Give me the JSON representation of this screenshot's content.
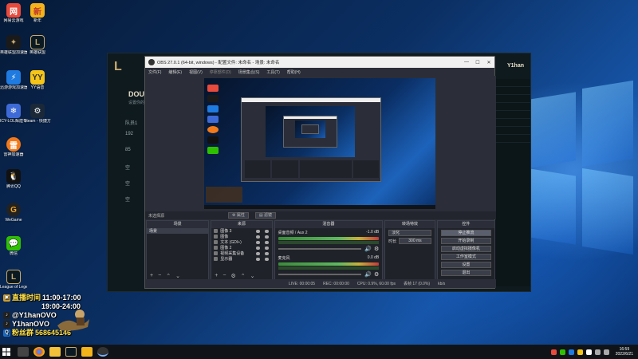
{
  "desktop": {
    "icons": [
      {
        "label": "网易云游戏",
        "icon": "netease-cloud-game-icon",
        "color": "#e84a3c"
      },
      {
        "label": "新年",
        "icon": "new-year-badge-icon",
        "color": "#f3b31b"
      },
      {
        "label": "英雄联盟加速器",
        "icon": "lol-accelerator-icon",
        "color": "#1a1a1a"
      },
      {
        "label": "英雄联盟",
        "icon": "league-of-legends-icon",
        "color": "#0b1a22"
      },
      {
        "label": "迅游游戏加速器",
        "icon": "xunyou-accelerator-icon",
        "color": "#1f7be0"
      },
      {
        "label": "YY语音",
        "icon": "yy-voice-icon",
        "color": "#f5c518"
      },
      {
        "label": "ICY-LOL辉煌专用版",
        "icon": "icy-lol-icon",
        "color": "#3d6ad6"
      },
      {
        "label": "Steam - 快捷方式",
        "icon": "steam-icon",
        "color": "#1b2838"
      },
      {
        "label": "雷神加速器",
        "icon": "leishen-accelerator-icon",
        "color": "#f27a1a"
      },
      {
        "label": "腾讯QQ",
        "icon": "qq-penguin-icon",
        "color": "#111111"
      },
      {
        "label": "WeGame",
        "icon": "wegame-icon",
        "color": "#222222"
      },
      {
        "label": "微信",
        "icon": "wechat-icon",
        "color": "#2dc100"
      },
      {
        "label": "League of Legends",
        "icon": "league-of-legends-icon",
        "color": "#0b1a22"
      }
    ]
  },
  "lol_client": {
    "title": "DOU",
    "subtitle": "设置你的...",
    "rows": [
      "队员1",
      "192",
      "85",
      "空",
      "空",
      "空"
    ],
    "user": "Y1han"
  },
  "obs": {
    "window_title": "OBS 27.0.1 (64-bit, windows) - 配置文件: 未命名 - 场景: 未命名",
    "menu": [
      "文件(F)",
      "编辑(E)",
      "视图(V)",
      "停靠部件(D)",
      "场景集合(S)",
      "工具(T)",
      "帮助(H)"
    ],
    "no_source": "未选择源",
    "properties_label": "属性",
    "filters_label": "滤镜",
    "docks": {
      "scenes": {
        "header": "场景",
        "items": [
          "场景"
        ]
      },
      "sources": {
        "header": "来源",
        "items": [
          "图像 3",
          "图像",
          "文本 (GDI+)",
          "图像 2",
          "视频采集设备",
          "显示器"
        ]
      },
      "mixer": {
        "header": "混音器",
        "tracks": [
          {
            "name": "桌面音频 / Aux 2",
            "db": "-1.0 dB"
          },
          {
            "name": "麦克风",
            "db": "0.0 dB"
          }
        ]
      },
      "transitions": {
        "header": "转场特效",
        "type": "淡化",
        "duration_label": "时长",
        "duration": "300 ms"
      },
      "controls": {
        "header": "控件",
        "buttons": [
          "停止推流",
          "开始录制",
          "启动虚拟摄像机",
          "工作室模式",
          "设置",
          "退出"
        ]
      }
    },
    "status": {
      "live": "LIVE: 00:00:05",
      "rec": "REC: 00:00:00",
      "cpu": "CPU: 0.9%, 60.00 fps",
      "dropped": "丢帧 17 (0.0%)",
      "bitrate": "kb/s"
    }
  },
  "overlay": {
    "schedule_label": "直播时间",
    "schedule_1": "11:00-17:00",
    "schedule_2": "19:00-24:00",
    "douyin": "@Y1hanOVO",
    "tiktok": "Y1hanOVO",
    "fan_group_label": "粉丝群",
    "fan_group": "568645146"
  },
  "taskbar": {
    "time": "16:59",
    "date": "2022/6/21"
  }
}
